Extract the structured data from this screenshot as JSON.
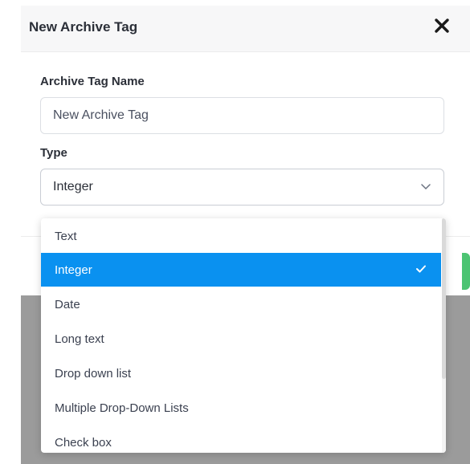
{
  "modal": {
    "title": "New Archive Tag",
    "close_icon": "close-icon"
  },
  "form": {
    "name_label": "Archive Tag Name",
    "name_value": "New Archive Tag",
    "type_label": "Type",
    "type_value": "Integer"
  },
  "dropdown": {
    "options": [
      {
        "label": "Text",
        "selected": false
      },
      {
        "label": "Integer",
        "selected": true
      },
      {
        "label": "Date",
        "selected": false
      },
      {
        "label": "Long text",
        "selected": false
      },
      {
        "label": "Drop down list",
        "selected": false
      },
      {
        "label": "Multiple Drop-Down Lists",
        "selected": false
      },
      {
        "label": "Check box",
        "selected": false
      }
    ]
  },
  "colors": {
    "accent": "#0a91f0",
    "confirm_button": "#4cc472",
    "overlay": "#9b9b9b"
  }
}
